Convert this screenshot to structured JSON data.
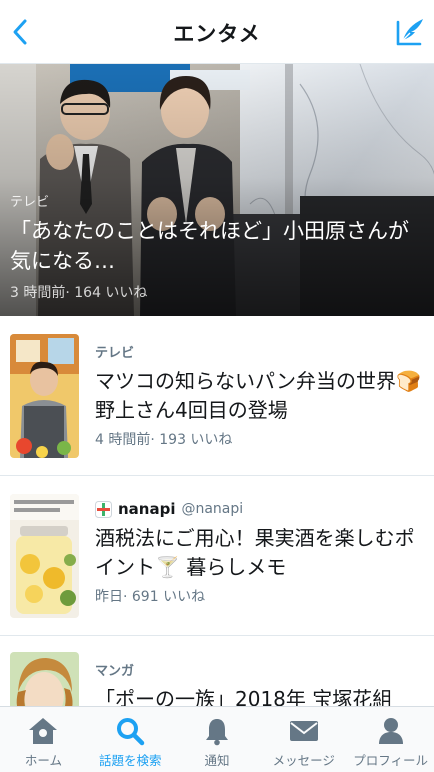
{
  "header": {
    "title": "エンタメ",
    "accent": "#1da1f2"
  },
  "hero": {
    "category": "テレビ",
    "headline": "「あなたのことはそれほど」小田原さんが気になる…",
    "meta": "3 時間前· 164 いいね"
  },
  "items": [
    {
      "category": "テレビ",
      "headline": "マツコの知らないパン弁当の世界🍞 野上さん4回目の登場",
      "meta": "4 時間前· 193 いいね"
    },
    {
      "source_name": "nanapi",
      "source_handle": "@nanapi",
      "headline": "酒税法にご用心！果実酒を楽しむポイント🍸 暮らしメモ",
      "meta": "昨日· 691 いいね"
    },
    {
      "category": "マンガ",
      "headline": "「ポーの一族」2018年 宝塚花組"
    }
  ],
  "tabbar": {
    "tabs": [
      {
        "label": "ホーム",
        "icon": "home-icon"
      },
      {
        "label": "話題を検索",
        "icon": "search-icon"
      },
      {
        "label": "通知",
        "icon": "bell-icon"
      },
      {
        "label": "メッセージ",
        "icon": "envelope-icon"
      },
      {
        "label": "プロフィール",
        "icon": "person-icon"
      }
    ],
    "active_color": "#1da1f2",
    "inactive_color": "#657786"
  }
}
